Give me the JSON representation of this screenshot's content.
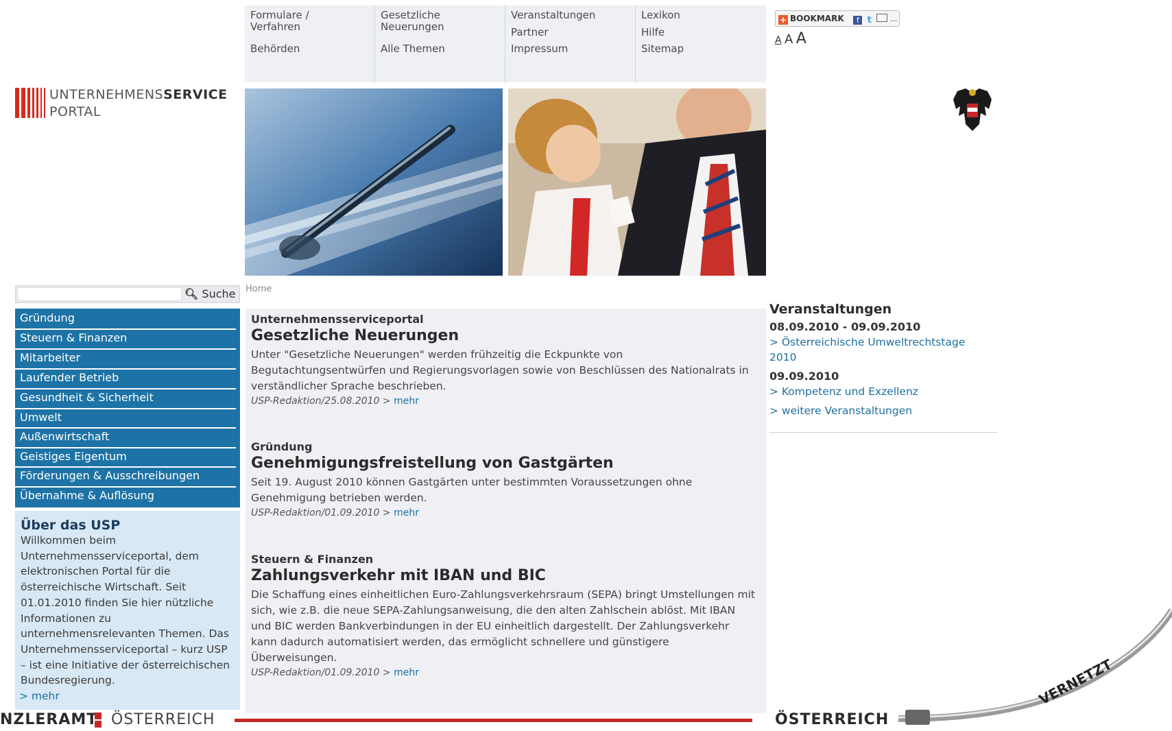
{
  "topnav": {
    "col1": [
      "Formulare / Verfahren",
      "Behörden"
    ],
    "col2": [
      "Gesetzliche Neuerungen",
      "Alle Themen"
    ],
    "col3": [
      "Veranstaltungen",
      "Partner",
      "Impressum"
    ],
    "col4": [
      "Lexikon",
      "Hilfe",
      "Sitemap"
    ]
  },
  "logo": {
    "line1_light": "UNTERNEHMENS",
    "line1_bold": "SERVICE",
    "line2": "PORTAL"
  },
  "bookmark": {
    "label": "BOOKMARK",
    "more": "..."
  },
  "textsize": {
    "small": "A",
    "medium": "A",
    "large": "A"
  },
  "search": {
    "value": "",
    "button_label": "Suche"
  },
  "leftnav": {
    "items": [
      "Gründung",
      "Steuern & Finanzen",
      "Mitarbeiter",
      "Laufender Betrieb",
      "Gesundheit & Sicherheit",
      "Umwelt",
      "Außenwirtschaft",
      "Geistiges Eigentum",
      "Förderungen & Ausschreibungen",
      "Übernahme & Auflösung"
    ]
  },
  "about": {
    "title": "Über das USP",
    "text": "Willkommen beim Unternehmensserviceportal, dem elektronischen Portal für die österreichische Wirtschaft. Seit 01.01.2010 finden Sie hier nützliche Informationen zu unternehmensrelevanten Themen. Das Unternehmensserviceportal – kurz USP – ist eine Initiative der österreichischen Bundesregierung.",
    "more": "> mehr"
  },
  "breadcrumb": "Home",
  "articles": [
    {
      "kicker": "Unternehmensserviceportal",
      "title": "Gesetzliche Neuerungen",
      "body": "Unter \"Gesetzliche Neuerungen\" werden frühzeitig die Eckpunkte von Begutachtungsentwürfen und Regierungsvorlagen sowie von Beschlüssen des Nationalrats in verständlicher Sprache beschrieben.",
      "meta": "USP-Redaktion/25.08.2010 >",
      "more": "mehr"
    },
    {
      "kicker": "Gründung",
      "title": "Genehmigungsfreistellung von Gastgärten",
      "body": "Seit 19. August 2010 können Gastgärten unter bestimmten Voraussetzungen ohne Genehmigung betrieben werden.",
      "meta": "USP-Redaktion/01.09.2010 >",
      "more": "mehr"
    },
    {
      "kicker": "Steuern & Finanzen",
      "title": "Zahlungsverkehr mit IBAN und BIC",
      "body": "Die Schaffung eines einheitlichen Euro-Zahlungsverkehrsraum (SEPA) bringt Umstellungen mit sich, wie z.B. die neue SEPA-Zahlungsanweisung, die den alten Zahlschein ablöst. Mit IBAN und BIC werden Bankverbindungen in der EU einheitlich dargestellt. Der Zahlungsverkehr kann dadurch automatisiert werden, das ermöglicht schnellere und günstigere Überweisungen.",
      "meta": "USP-Redaktion/01.09.2010 >",
      "more": "mehr"
    }
  ],
  "events": {
    "title": "Veranstaltungen",
    "items": [
      {
        "date": "08.09.2010 - 09.09.2010",
        "link": "> Österreichische Umweltrechtstage 2010"
      },
      {
        "date": "09.09.2010",
        "link": "> Kompetenz und Exzellenz"
      }
    ],
    "more": "> weitere Veranstaltungen"
  },
  "footer": {
    "left": "NZLERAMT",
    "left2": "ÖSTERREICH",
    "right": "ÖSTERREICH",
    "stamp": "VERNETZT"
  },
  "colors": {
    "nav_blue": "#1d73a6",
    "about_bg": "#d8e8f4",
    "brand_red": "#d52b1e",
    "main_bg": "#eef0f4"
  }
}
